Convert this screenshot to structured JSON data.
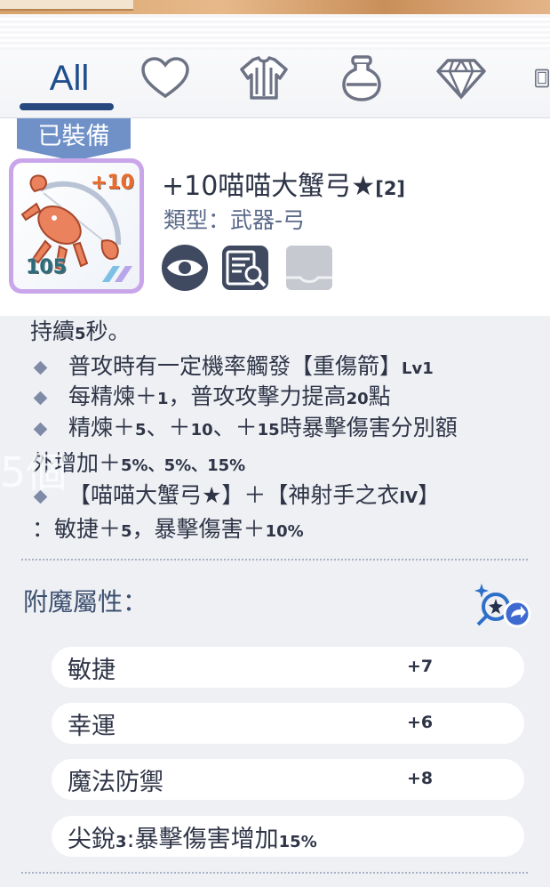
{
  "tabs": {
    "all_label": "All",
    "items": [
      {
        "name": "heart-icon"
      },
      {
        "name": "armor-icon"
      },
      {
        "name": "potion-icon"
      },
      {
        "name": "gem-icon"
      },
      {
        "name": "card-icon"
      }
    ]
  },
  "item": {
    "equipped_label": "已裝備",
    "refine": "+10",
    "level": "105",
    "name_main": "+10喵喵大蟹弓★",
    "name_sub": "[2]",
    "type_label": "類型：武器-弓"
  },
  "actions": [
    {
      "name": "view-eye-icon"
    },
    {
      "name": "inspect-details-icon"
    },
    {
      "name": "tray-icon"
    }
  ],
  "description": {
    "line0_text": "持續",
    "line0_sm": "5",
    "line0_tail": "秒。",
    "bullet1_text": "普攻時有一定機率觸發【重傷箭】",
    "bullet1_sm": "Lv1",
    "bullet2_text": "每精煉＋",
    "bullet2_sm1": "1",
    "bullet2_mid": "，普攻攻擊力提高",
    "bullet2_sm2": "20",
    "bullet2_tail": "點",
    "bullet3_a": "精煉＋",
    "bullet3_b": "5",
    "bullet3_c": "、＋",
    "bullet3_d": "10",
    "bullet3_e": "、＋",
    "bullet3_f": "15",
    "bullet3_g": "時暴擊傷害分別額",
    "bullet3_cont_a": "外增加＋",
    "bullet3_cont_b": "5%、5%、15%",
    "bullet4_text": "【喵喵大蟹弓★】＋【神射手之衣",
    "bullet4_sm": "IV",
    "bullet4_tail": "】",
    "bullet4_cont_a": "：敏捷＋",
    "bullet4_cont_b": "5",
    "bullet4_cont_c": "，暴擊傷害＋",
    "bullet4_cont_d": "10%",
    "watermark": "5個"
  },
  "enchant": {
    "title": "附魔屬性：",
    "attrs": [
      {
        "name": "敏捷",
        "value": "+7"
      },
      {
        "name": "幸運",
        "value": "+6"
      },
      {
        "name": "魔法防禦",
        "value": "+8"
      }
    ],
    "sharp_a": "尖銳",
    "sharp_b": "3",
    "sharp_c": ":暴擊傷害增加",
    "sharp_d": "15%"
  },
  "colors": {
    "accent": "#27487f",
    "frame_purple": "#c9a6ea",
    "badge_blue": "#6f91c8"
  }
}
